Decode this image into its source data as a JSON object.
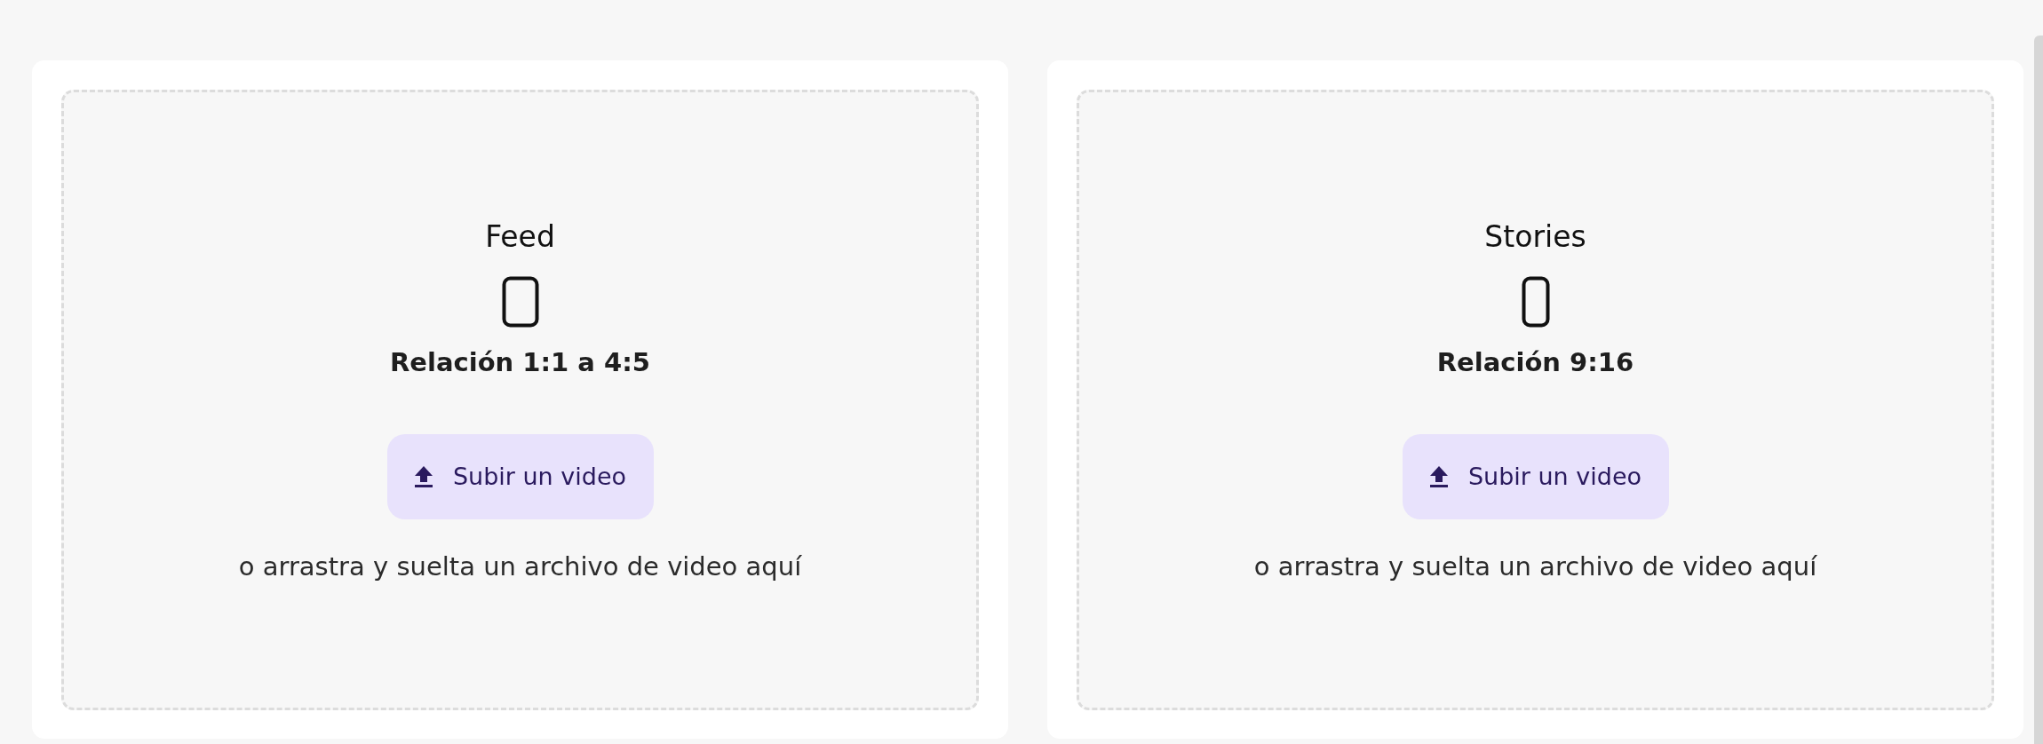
{
  "upload_cards": [
    {
      "title": "Feed",
      "kind": "portrait",
      "ratio": "Relación 1:1 a 4:5",
      "button": "Subir un video",
      "hint": "o arrastra y suelta un archivo de video aquí"
    },
    {
      "title": "Stories",
      "kind": "tall",
      "ratio": "Relación 9:16",
      "button": "Subir un video",
      "hint": "o arrastra y suelta un archivo de video aquí"
    }
  ]
}
